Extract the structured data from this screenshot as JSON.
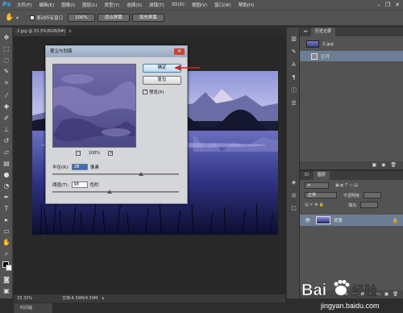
{
  "menu": {
    "logo": "Ps",
    "items": [
      "文件(F)",
      "编辑(E)",
      "图像(I)",
      "图层(L)",
      "类型(Y)",
      "选择(S)",
      "滤镜(T)",
      "3D(D)",
      "视图(V)",
      "窗口(W)",
      "帮助(H)"
    ]
  },
  "options_bar": {
    "scroll_all_label": "滚动所有窗口",
    "btn_100": "100%",
    "btn_fit": "适合屏幕",
    "btn_fill": "填充屏幕"
  },
  "document": {
    "tab_label": "2.jpg @ 33.3%(RGB/8#)",
    "zoom": "33.33%",
    "doc_info": "文档:4.59M/4.59M",
    "bottom_tab": "时间轴"
  },
  "dialog": {
    "title": "蒙尘与划痕",
    "ok_label": "确定",
    "reset_label": "复位",
    "preview_label": "预览(P)",
    "preview_checked": true,
    "zoom_value": "100%",
    "radius_label": "半径(R):",
    "radius_value": "28",
    "radius_unit": "像素",
    "radius_slider": 0.7,
    "threshold_label": "阈值(T):",
    "threshold_value": "98",
    "threshold_unit": "色阶",
    "threshold_slider": 0.45
  },
  "history_panel": {
    "tab1": "历史记录",
    "snapshot_name": "2.jpg",
    "steps": [
      "打开"
    ]
  },
  "layers_panel": {
    "tab_3d": "3D",
    "tab_layers": "图层",
    "blend_mode": "正常",
    "opacity_label": "不透明度:",
    "fill_label": "填充:",
    "layer_name": "背景"
  },
  "watermark": {
    "brand": "Bai",
    "brand2": "经验",
    "url": "jingyan.baidu.com"
  },
  "colors": {
    "accent": "#31a8ff",
    "selection": "#6d7d93",
    "annotation_arrow": "#e02020"
  }
}
